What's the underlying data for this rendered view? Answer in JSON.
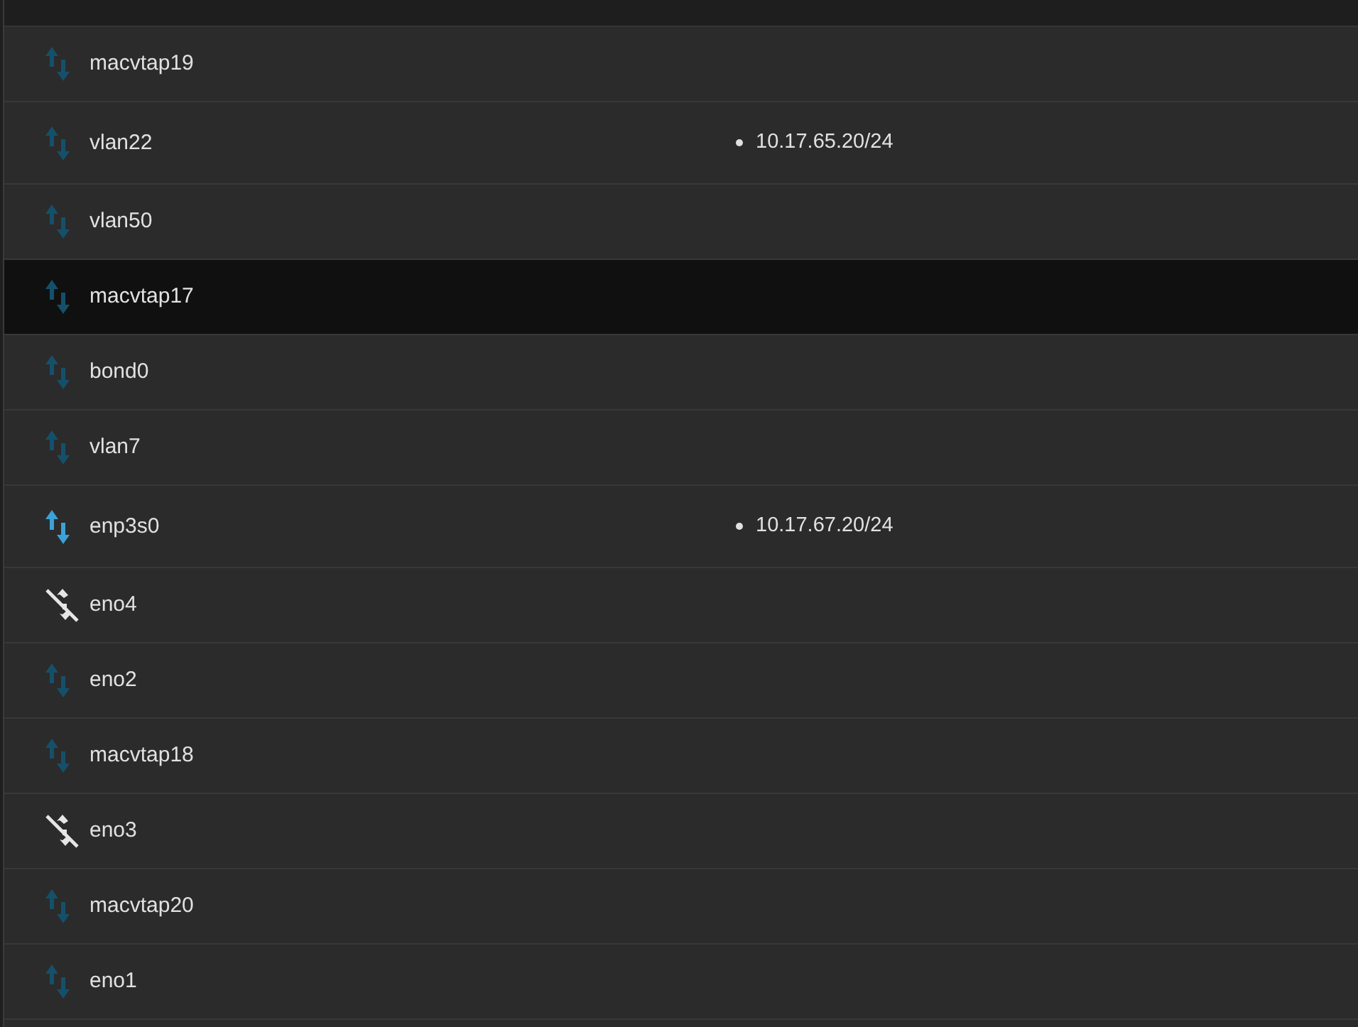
{
  "table": {
    "rows": [
      {
        "name": "macvtap19",
        "kind": "inactive",
        "highlighted": false
      },
      {
        "name": "vlan22",
        "kind": "inactive",
        "highlighted": false,
        "addresses": [
          "10.17.65.20/24"
        ]
      },
      {
        "name": "vlan50",
        "kind": "inactive",
        "highlighted": false
      },
      {
        "name": "macvtap17",
        "kind": "inactive",
        "highlighted": true
      },
      {
        "name": "bond0",
        "kind": "inactive",
        "highlighted": false
      },
      {
        "name": "vlan7",
        "kind": "inactive",
        "highlighted": false
      },
      {
        "name": "enp3s0",
        "kind": "active",
        "highlighted": false,
        "addresses": [
          "10.17.67.20/24"
        ]
      },
      {
        "name": "eno4",
        "kind": "down",
        "highlighted": false
      },
      {
        "name": "eno2",
        "kind": "inactive",
        "highlighted": false
      },
      {
        "name": "macvtap18",
        "kind": "inactive",
        "highlighted": false
      },
      {
        "name": "eno3",
        "kind": "down",
        "highlighted": false
      },
      {
        "name": "macvtap20",
        "kind": "inactive",
        "highlighted": false
      },
      {
        "name": "eno1",
        "kind": "inactive",
        "highlighted": false
      }
    ]
  }
}
